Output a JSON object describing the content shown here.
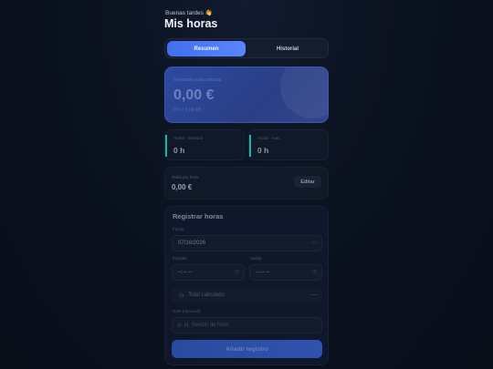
{
  "header": {
    "greeting": "Buenas tardes 👋",
    "title": "Mis horas"
  },
  "tabs": [
    {
      "label": "Resumen",
      "active": true
    },
    {
      "label": "Historial",
      "active": false
    }
  ],
  "summary": {
    "label": "Generado esta semana",
    "amount": "0,00 €",
    "detail": "0 h × 0,00 €/h"
  },
  "stats": [
    {
      "label": "Horas · semana",
      "value": "0 h"
    },
    {
      "label": "Horas · mes",
      "value": "0 h"
    }
  ],
  "rate": {
    "label": "Tarifa por hora",
    "value": "0,00 €",
    "edit_label": "Editar"
  },
  "form": {
    "title": "Registrar horas",
    "date_label": "Fecha",
    "date_value": "07/16/2026",
    "start_label": "Entrada",
    "start_value": "--:-- --",
    "end_label": "Salida",
    "end_value": "--:-- --",
    "total_text": "Total calculado",
    "total_value": "—",
    "note_label": "Nota (opcional)",
    "note_placeholder": "p. ej. Sesión de fotos",
    "submit_label": "Añadir registro"
  },
  "colors": {
    "accent": "#4a78f5",
    "teal": "#1fb0a8",
    "background": "#0b1220"
  }
}
